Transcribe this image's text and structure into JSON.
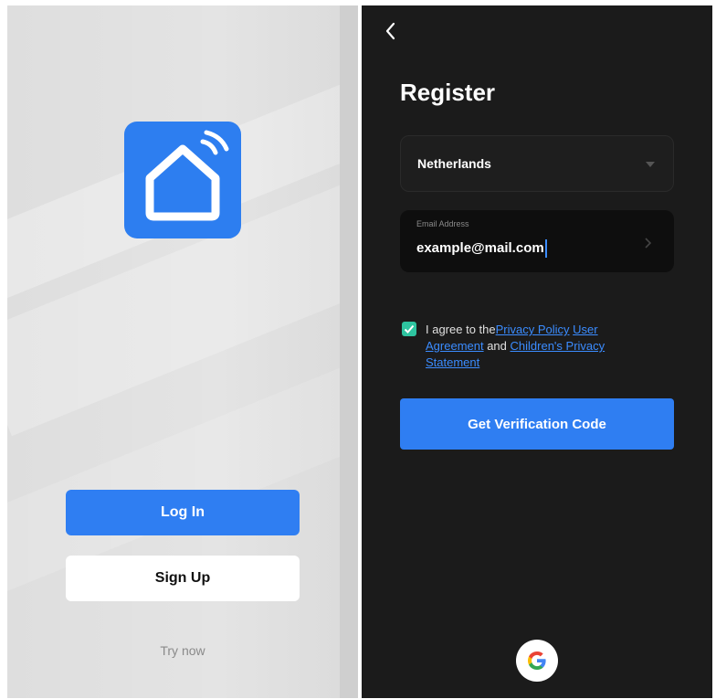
{
  "welcome_screen": {
    "login_label": "Log In",
    "signup_label": "Sign Up",
    "try_now_label": "Try now",
    "logo_icon": "smart-home-icon",
    "logo_color": "#2d7ef0"
  },
  "register_screen": {
    "back_icon": "chevron-left-icon",
    "title": "Register",
    "country": {
      "value": "Netherlands",
      "icon": "chevron-down-icon"
    },
    "email": {
      "label": "Email Address",
      "value": "example@mail.com",
      "icon": "chevron-right-icon"
    },
    "agreement": {
      "checked": true,
      "prefix": "I agree to the",
      "privacy_policy": "Privacy Policy",
      "user_agreement": "User Agreement",
      "and": " and ",
      "childrens_privacy": "Children's Privacy Statement"
    },
    "verify_label": "Get Verification Code",
    "google_icon": "google-icon"
  },
  "colors": {
    "accent": "#2f7ef2",
    "check": "#2ec4a0",
    "dark_bg": "#1b1b1b"
  }
}
